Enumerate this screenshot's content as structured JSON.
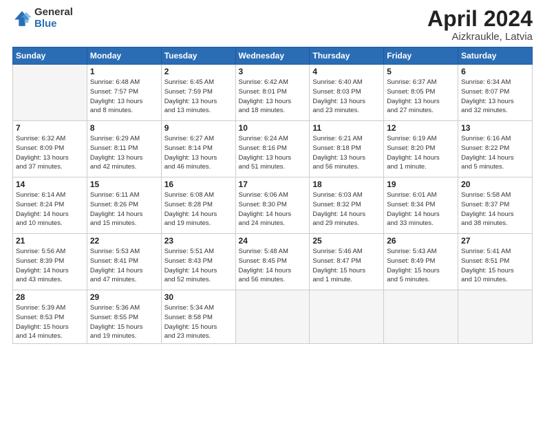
{
  "header": {
    "logo_general": "General",
    "logo_blue": "Blue",
    "title": "April 2024",
    "location": "Aizkraukle, Latvia"
  },
  "weekdays": [
    "Sunday",
    "Monday",
    "Tuesday",
    "Wednesday",
    "Thursday",
    "Friday",
    "Saturday"
  ],
  "weeks": [
    [
      {
        "day": "",
        "info": ""
      },
      {
        "day": "1",
        "info": "Sunrise: 6:48 AM\nSunset: 7:57 PM\nDaylight: 13 hours\nand 8 minutes."
      },
      {
        "day": "2",
        "info": "Sunrise: 6:45 AM\nSunset: 7:59 PM\nDaylight: 13 hours\nand 13 minutes."
      },
      {
        "day": "3",
        "info": "Sunrise: 6:42 AM\nSunset: 8:01 PM\nDaylight: 13 hours\nand 18 minutes."
      },
      {
        "day": "4",
        "info": "Sunrise: 6:40 AM\nSunset: 8:03 PM\nDaylight: 13 hours\nand 23 minutes."
      },
      {
        "day": "5",
        "info": "Sunrise: 6:37 AM\nSunset: 8:05 PM\nDaylight: 13 hours\nand 27 minutes."
      },
      {
        "day": "6",
        "info": "Sunrise: 6:34 AM\nSunset: 8:07 PM\nDaylight: 13 hours\nand 32 minutes."
      }
    ],
    [
      {
        "day": "7",
        "info": "Sunrise: 6:32 AM\nSunset: 8:09 PM\nDaylight: 13 hours\nand 37 minutes."
      },
      {
        "day": "8",
        "info": "Sunrise: 6:29 AM\nSunset: 8:11 PM\nDaylight: 13 hours\nand 42 minutes."
      },
      {
        "day": "9",
        "info": "Sunrise: 6:27 AM\nSunset: 8:14 PM\nDaylight: 13 hours\nand 46 minutes."
      },
      {
        "day": "10",
        "info": "Sunrise: 6:24 AM\nSunset: 8:16 PM\nDaylight: 13 hours\nand 51 minutes."
      },
      {
        "day": "11",
        "info": "Sunrise: 6:21 AM\nSunset: 8:18 PM\nDaylight: 13 hours\nand 56 minutes."
      },
      {
        "day": "12",
        "info": "Sunrise: 6:19 AM\nSunset: 8:20 PM\nDaylight: 14 hours\nand 1 minute."
      },
      {
        "day": "13",
        "info": "Sunrise: 6:16 AM\nSunset: 8:22 PM\nDaylight: 14 hours\nand 5 minutes."
      }
    ],
    [
      {
        "day": "14",
        "info": "Sunrise: 6:14 AM\nSunset: 8:24 PM\nDaylight: 14 hours\nand 10 minutes."
      },
      {
        "day": "15",
        "info": "Sunrise: 6:11 AM\nSunset: 8:26 PM\nDaylight: 14 hours\nand 15 minutes."
      },
      {
        "day": "16",
        "info": "Sunrise: 6:08 AM\nSunset: 8:28 PM\nDaylight: 14 hours\nand 19 minutes."
      },
      {
        "day": "17",
        "info": "Sunrise: 6:06 AM\nSunset: 8:30 PM\nDaylight: 14 hours\nand 24 minutes."
      },
      {
        "day": "18",
        "info": "Sunrise: 6:03 AM\nSunset: 8:32 PM\nDaylight: 14 hours\nand 29 minutes."
      },
      {
        "day": "19",
        "info": "Sunrise: 6:01 AM\nSunset: 8:34 PM\nDaylight: 14 hours\nand 33 minutes."
      },
      {
        "day": "20",
        "info": "Sunrise: 5:58 AM\nSunset: 8:37 PM\nDaylight: 14 hours\nand 38 minutes."
      }
    ],
    [
      {
        "day": "21",
        "info": "Sunrise: 5:56 AM\nSunset: 8:39 PM\nDaylight: 14 hours\nand 43 minutes."
      },
      {
        "day": "22",
        "info": "Sunrise: 5:53 AM\nSunset: 8:41 PM\nDaylight: 14 hours\nand 47 minutes."
      },
      {
        "day": "23",
        "info": "Sunrise: 5:51 AM\nSunset: 8:43 PM\nDaylight: 14 hours\nand 52 minutes."
      },
      {
        "day": "24",
        "info": "Sunrise: 5:48 AM\nSunset: 8:45 PM\nDaylight: 14 hours\nand 56 minutes."
      },
      {
        "day": "25",
        "info": "Sunrise: 5:46 AM\nSunset: 8:47 PM\nDaylight: 15 hours\nand 1 minute."
      },
      {
        "day": "26",
        "info": "Sunrise: 5:43 AM\nSunset: 8:49 PM\nDaylight: 15 hours\nand 5 minutes."
      },
      {
        "day": "27",
        "info": "Sunrise: 5:41 AM\nSunset: 8:51 PM\nDaylight: 15 hours\nand 10 minutes."
      }
    ],
    [
      {
        "day": "28",
        "info": "Sunrise: 5:39 AM\nSunset: 8:53 PM\nDaylight: 15 hours\nand 14 minutes."
      },
      {
        "day": "29",
        "info": "Sunrise: 5:36 AM\nSunset: 8:55 PM\nDaylight: 15 hours\nand 19 minutes."
      },
      {
        "day": "30",
        "info": "Sunrise: 5:34 AM\nSunset: 8:58 PM\nDaylight: 15 hours\nand 23 minutes."
      },
      {
        "day": "",
        "info": ""
      },
      {
        "day": "",
        "info": ""
      },
      {
        "day": "",
        "info": ""
      },
      {
        "day": "",
        "info": ""
      }
    ]
  ]
}
